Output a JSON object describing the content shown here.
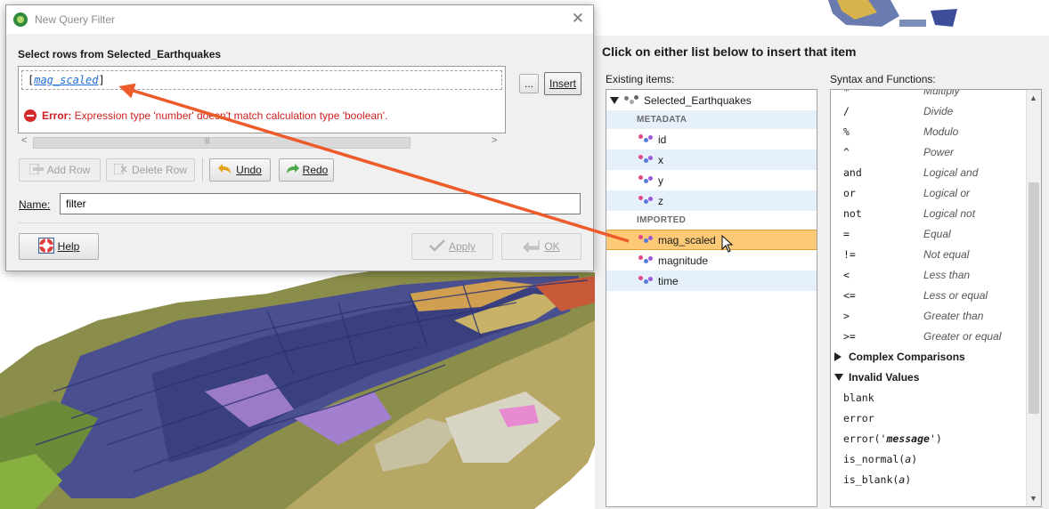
{
  "dialog": {
    "title": "New Query Filter",
    "select_heading": "Select rows from Selected_Earthquakes",
    "expression_open": "[",
    "expression_field": "mag_scaled",
    "expression_close": "]",
    "error_label": "Error:",
    "error_message": " Expression type 'number' doesn't match calculation type 'boolean'.",
    "ellipsis_label": "...",
    "insert_label": "Insert",
    "add_row_label": "Add Row",
    "delete_row_label": "Delete Row",
    "undo_label": "Undo",
    "redo_label": "Redo",
    "name_label": "Name:",
    "name_value": "filter",
    "help_label": "Help",
    "apply_label": "Apply",
    "ok_label": "OK"
  },
  "panel": {
    "heading": "Click on either list below to insert that item",
    "existing_label": "Existing items:",
    "syntax_label": "Syntax and Functions:",
    "root_item": "Selected_Earthquakes",
    "metadata_section": "METADATA",
    "metadata_items": [
      "id",
      "x",
      "y",
      "z"
    ],
    "imported_section": "IMPORTED",
    "imported_items": [
      "mag_scaled",
      "magnitude",
      "time"
    ],
    "selected_item": "mag_scaled",
    "operators": [
      {
        "sym": "*",
        "desc": "Multiply"
      },
      {
        "sym": "/",
        "desc": "Divide"
      },
      {
        "sym": "%",
        "desc": "Modulo"
      },
      {
        "sym": "^",
        "desc": "Power"
      },
      {
        "sym": "and",
        "desc": "Logical and"
      },
      {
        "sym": "or",
        "desc": "Logical or"
      },
      {
        "sym": "not",
        "desc": "Logical not"
      },
      {
        "sym": "=",
        "desc": "Equal"
      },
      {
        "sym": "!=",
        "desc": "Not equal"
      },
      {
        "sym": "<",
        "desc": "Less than"
      },
      {
        "sym": "<=",
        "desc": "Less or equal"
      },
      {
        "sym": ">",
        "desc": "Greater than"
      },
      {
        "sym": ">=",
        "desc": "Greater or equal"
      }
    ],
    "group_complex": "Complex Comparisons",
    "group_invalid": "Invalid Values",
    "invalid_fn_blank": "blank",
    "invalid_fn_error": "error",
    "invalid_fn_error_msg_pre": "error('",
    "invalid_fn_error_msg_arg": "message",
    "invalid_fn_error_msg_post": "')",
    "invalid_fn_is_normal_pre": "is_normal(",
    "invalid_fn_is_blank_pre": "is_blank(",
    "invalid_fn_arg": "a",
    "invalid_fn_close": ")"
  },
  "colors": {
    "accent_arrow": "#ee5b2a",
    "error_red": "#cc1f1f",
    "selection": "#fcc977",
    "alt_row": "#e6f0fa"
  }
}
